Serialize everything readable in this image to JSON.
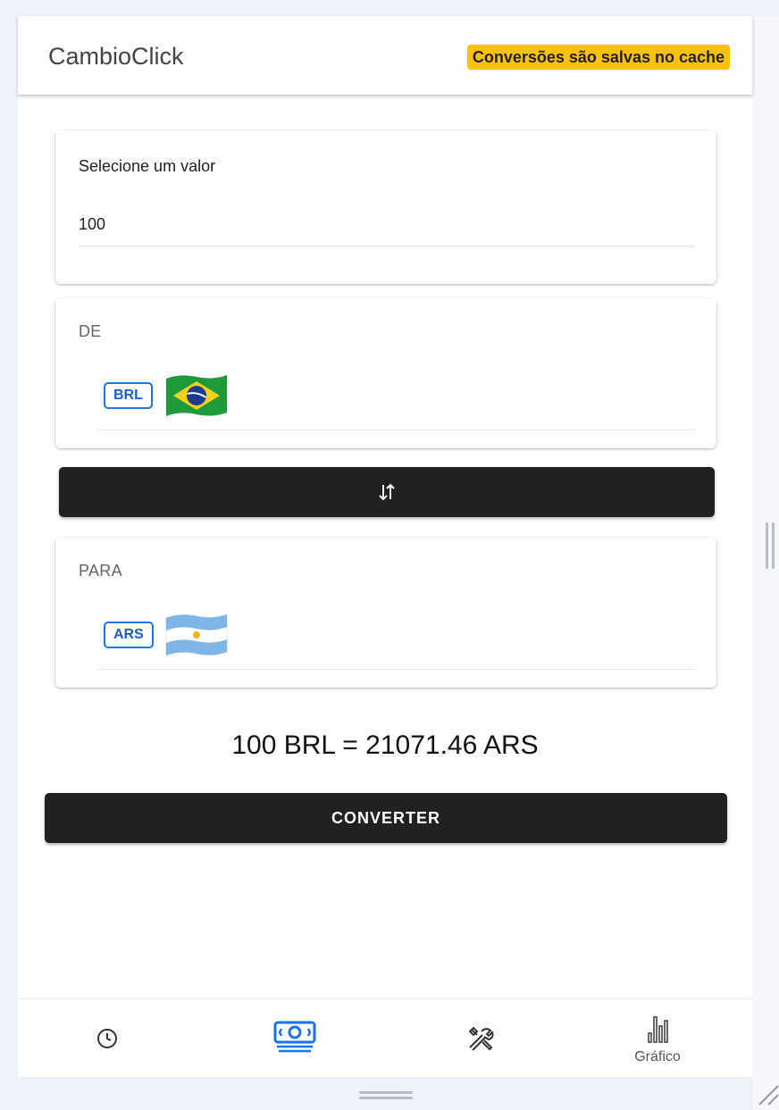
{
  "app": {
    "title": "CambioClick",
    "cache_notice": "Conversões são salvas no cache"
  },
  "amount": {
    "label": "Selecione um valor",
    "value": "100"
  },
  "from": {
    "label": "DE",
    "currency_code": "BRL",
    "flag_icon": "brazil-flag-icon"
  },
  "to": {
    "label": "PARA",
    "currency_code": "ARS",
    "flag_icon": "argentina-flag-icon"
  },
  "swap": {
    "icon": "swap-vertical-icon"
  },
  "result": {
    "text": "100 BRL = 21071.46 ARS"
  },
  "convert_button": {
    "label": "CONVERTER"
  },
  "bottom_nav": {
    "items": [
      {
        "icon": "clock-icon",
        "label": "",
        "active": false
      },
      {
        "icon": "money-icon",
        "label": "",
        "active": true
      },
      {
        "icon": "tools-icon",
        "label": "",
        "active": false
      },
      {
        "icon": "bar-chart-icon",
        "label": "Gráfico",
        "active": false
      }
    ]
  },
  "colors": {
    "accent": "#1a73e8",
    "badge": "#ffc107",
    "button_dark": "#212124"
  }
}
